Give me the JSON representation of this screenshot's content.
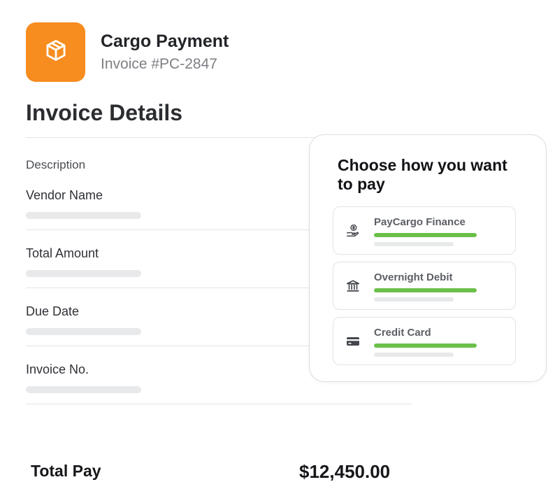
{
  "header": {
    "title": "Cargo Payment",
    "invoice_number": "Invoice #PC-2847",
    "logo_icon": "package-box-icon",
    "brand_color": "#f78c1f"
  },
  "details": {
    "section_title": "Invoice Details",
    "description_label": "Description",
    "fields": [
      {
        "label": "Vendor Name"
      },
      {
        "label": "Total Amount"
      },
      {
        "label": "Due Date"
      },
      {
        "label": "Invoice No."
      }
    ]
  },
  "payment": {
    "heading": "Choose how you want to pay",
    "options": [
      {
        "label": "PayCargo Finance",
        "icon": "hand-coin-icon"
      },
      {
        "label": "Overnight Debit",
        "icon": "bank-icon"
      },
      {
        "label": "Credit Card",
        "icon": "credit-card-icon"
      }
    ],
    "accent_color": "#6cc04a"
  },
  "footer": {
    "total_label": "Total Pay",
    "total_value": "$12,450.00"
  }
}
